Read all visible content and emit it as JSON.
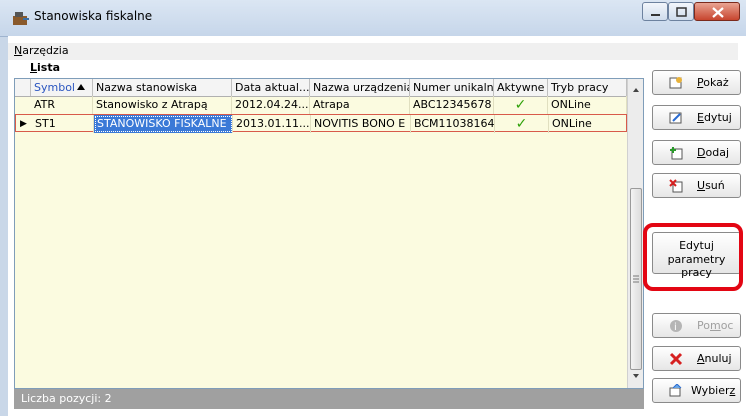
{
  "window": {
    "title": "Stanowiska fiskalne",
    "minimize_glyph": "–",
    "maximize_glyph": "□",
    "close_glyph": "X",
    "app_icon": "cash-register-icon"
  },
  "menu": {
    "items": [
      {
        "label_u": "N",
        "label_rest": "arzędzia"
      }
    ]
  },
  "grid": {
    "section_label_u": "L",
    "section_label_rest": "ista",
    "sort_column": "Symbol",
    "columns": [
      "Symbol",
      "Nazwa stanowiska",
      "Data aktual...",
      "Nazwa urządzenia",
      "Numer unikalny",
      "Aktywne",
      "Tryb pracy"
    ],
    "rows": [
      {
        "symbol": "ATR",
        "nazwa": "Stanowisko z Atrapą",
        "data": "2012.04.24...",
        "urzadzenie": "Atrapa",
        "numer": "ABC12345678",
        "aktywne": "✓",
        "tryb": "ONLine"
      },
      {
        "symbol": "ST1",
        "nazwa": "STANOWISKO FISKALNE",
        "data": "2013.01.11...",
        "urzadzenie": "NOVITIS BONO E",
        "numer": "BCM11038164",
        "aktywne": "✓",
        "tryb": "ONLine"
      }
    ],
    "current_row_marker": "▶",
    "check_color": "#2fa10a"
  },
  "status": {
    "count_text": "Liczba pozycji: 2"
  },
  "buttons": {
    "pokaz": {
      "u": "P",
      "rest": "okaż",
      "icon": "view-icon"
    },
    "edytuj": {
      "u": "E",
      "rest": "dytuj",
      "icon": "edit-icon"
    },
    "dodaj": {
      "u": "D",
      "rest": "odaj",
      "icon": "add-icon"
    },
    "usun": {
      "u": "U",
      "rest": "suń",
      "icon": "delete-icon"
    },
    "params": {
      "line1": "Edytuj",
      "line2": "parametry pracy"
    },
    "pomoc": {
      "pre": "Po",
      "u": "m",
      "rest": "oc",
      "icon": "help-icon"
    },
    "anuluj": {
      "u": "A",
      "rest": "nuluj",
      "icon": "cancel-icon"
    },
    "wybierz": {
      "pre": "Wybier",
      "u": "z",
      "rest": "",
      "icon": "select-icon"
    }
  },
  "colors": {
    "highlight": "#e30613",
    "selection": "#3a79d7",
    "grid_bg": "#fbfbe0"
  }
}
